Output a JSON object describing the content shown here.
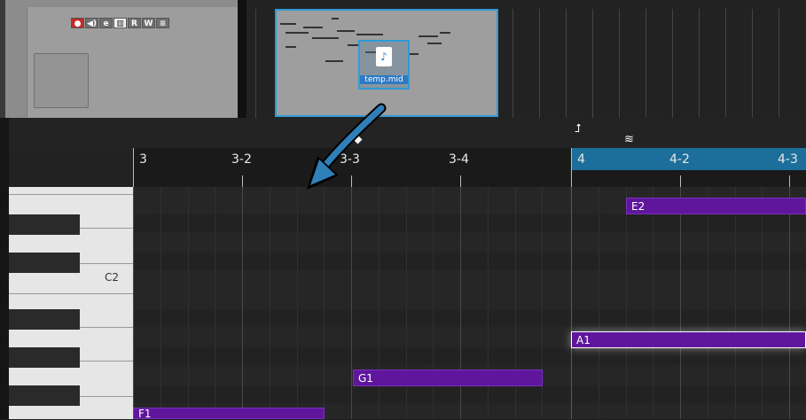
{
  "track_header": {
    "buttons": [
      "●",
      "◀)",
      "e",
      "▥",
      "R",
      "W",
      "≡"
    ]
  },
  "drag_item": {
    "file_name": "temp.mid",
    "icon": "midi-file-icon"
  },
  "ruler": {
    "labels": [
      "3",
      "3-2",
      "3-3",
      "3-4",
      "4",
      "4-2",
      "4-3"
    ]
  },
  "piano": {
    "label": "C2"
  },
  "markers": {
    "play_symbol": "⮥",
    "tempo_symbol": "≋"
  },
  "notes": [
    {
      "label": "E2"
    },
    {
      "label": "A1"
    },
    {
      "label": "G1"
    },
    {
      "label": "F1"
    }
  ],
  "colors": {
    "accent": "#2e9bd6",
    "note_fill": "#5f169c",
    "loop_bar": "#1b6f9a"
  }
}
